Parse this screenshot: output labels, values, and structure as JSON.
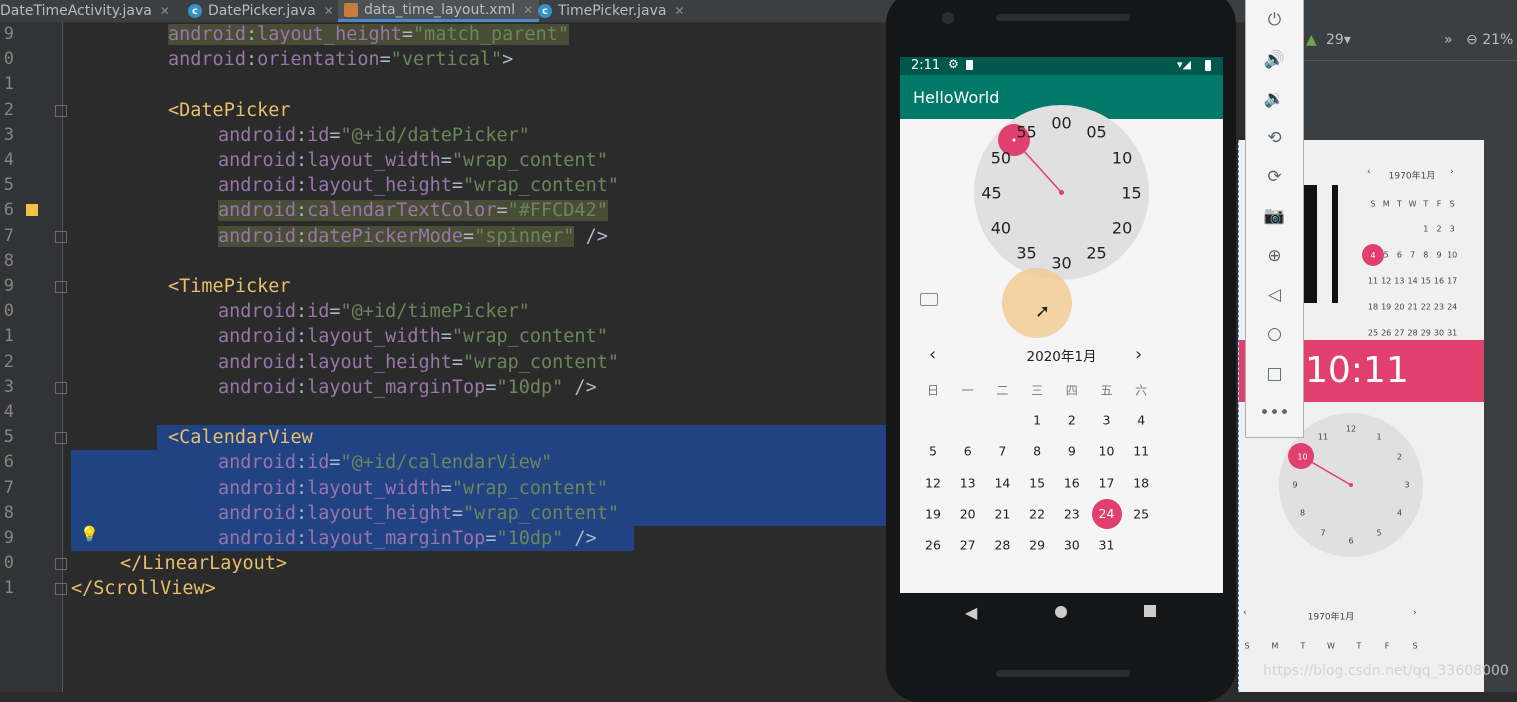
{
  "tabs": [
    {
      "label": "DateTimeActivity.java"
    },
    {
      "label": "DatePicker.java"
    },
    {
      "label": "data_time_layout.xml"
    },
    {
      "label": "TimePicker.java"
    }
  ],
  "editor": {
    "line_numbers": [
      "9",
      "0",
      "1",
      "2",
      "3",
      "4",
      "5",
      "6",
      "7",
      "8",
      "9",
      "0",
      "1",
      "2",
      "3",
      "4",
      "5",
      "6",
      "7",
      "8",
      "9",
      "0",
      "1"
    ],
    "lines": [
      {
        "tokens": [
          [
            "k",
            "android"
          ],
          [
            "p",
            ":"
          ],
          [
            "k",
            "layout_height"
          ],
          [
            "p",
            "="
          ],
          [
            "v",
            "\"match_parent\""
          ]
        ]
      },
      {
        "tokens": [
          [
            "k",
            "android"
          ],
          [
            "p",
            ":"
          ],
          [
            "k",
            "orientation"
          ],
          [
            "p",
            "="
          ],
          [
            "v",
            "\"vertical\""
          ],
          [
            "p",
            ">"
          ]
        ]
      },
      {
        "tokens": []
      },
      {
        "tokens": [
          [
            "t",
            "<DatePicker"
          ]
        ]
      },
      {
        "tokens": [
          [
            "k",
            "android"
          ],
          [
            "p",
            ":"
          ],
          [
            "k",
            "id"
          ],
          [
            "p",
            "="
          ],
          [
            "v",
            "\"@+id/datePicker\""
          ]
        ]
      },
      {
        "tokens": [
          [
            "k",
            "android"
          ],
          [
            "p",
            ":"
          ],
          [
            "k",
            "layout_width"
          ],
          [
            "p",
            "="
          ],
          [
            "v",
            "\"wrap_content\""
          ]
        ]
      },
      {
        "tokens": [
          [
            "k",
            "android"
          ],
          [
            "p",
            ":"
          ],
          [
            "k",
            "layout_height"
          ],
          [
            "p",
            "="
          ],
          [
            "v",
            "\"wrap_content\""
          ]
        ]
      },
      {
        "tokens": [
          [
            "k",
            "android"
          ],
          [
            "p",
            ":"
          ],
          [
            "k",
            "calendarTextColor"
          ],
          [
            "p",
            "="
          ],
          [
            "v",
            "\"#FFCD42\""
          ]
        ]
      },
      {
        "tokens": [
          [
            "k",
            "android"
          ],
          [
            "p",
            ":"
          ],
          [
            "k",
            "datePickerMode"
          ],
          [
            "p",
            "="
          ],
          [
            "v",
            "\"spinner\""
          ],
          [
            "p",
            " />"
          ]
        ]
      },
      {
        "tokens": []
      },
      {
        "tokens": [
          [
            "t",
            "<TimePicker"
          ]
        ]
      },
      {
        "tokens": [
          [
            "k",
            "android"
          ],
          [
            "p",
            ":"
          ],
          [
            "k",
            "id"
          ],
          [
            "p",
            "="
          ],
          [
            "v",
            "\"@+id/timePicker\""
          ]
        ]
      },
      {
        "tokens": [
          [
            "k",
            "android"
          ],
          [
            "p",
            ":"
          ],
          [
            "k",
            "layout_width"
          ],
          [
            "p",
            "="
          ],
          [
            "v",
            "\"wrap_content\""
          ]
        ]
      },
      {
        "tokens": [
          [
            "k",
            "android"
          ],
          [
            "p",
            ":"
          ],
          [
            "k",
            "layout_height"
          ],
          [
            "p",
            "="
          ],
          [
            "v",
            "\"wrap_content\""
          ]
        ]
      },
      {
        "tokens": [
          [
            "k",
            "android"
          ],
          [
            "p",
            ":"
          ],
          [
            "k",
            "layout_marginTop"
          ],
          [
            "p",
            "="
          ],
          [
            "v",
            "\"10dp\""
          ],
          [
            "p",
            " />"
          ]
        ]
      },
      {
        "tokens": []
      },
      {
        "tokens": [
          [
            "t",
            "<CalendarView"
          ]
        ]
      },
      {
        "tokens": [
          [
            "k",
            "android"
          ],
          [
            "p",
            ":"
          ],
          [
            "k",
            "id"
          ],
          [
            "p",
            "="
          ],
          [
            "v",
            "\"@+id/calendarView\""
          ]
        ]
      },
      {
        "tokens": [
          [
            "k",
            "android"
          ],
          [
            "p",
            ":"
          ],
          [
            "k",
            "layout_width"
          ],
          [
            "p",
            "="
          ],
          [
            "v",
            "\"wrap_content\""
          ]
        ]
      },
      {
        "tokens": [
          [
            "k",
            "android"
          ],
          [
            "p",
            ":"
          ],
          [
            "k",
            "layout_height"
          ],
          [
            "p",
            "="
          ],
          [
            "v",
            "\"wrap_content\""
          ]
        ]
      },
      {
        "tokens": [
          [
            "k",
            "android"
          ],
          [
            "p",
            ":"
          ],
          [
            "k",
            "layout_marginTop"
          ],
          [
            "p",
            "="
          ],
          [
            "v",
            "\"10dp\""
          ],
          [
            "p",
            " />"
          ]
        ]
      },
      {
        "tokens": [
          [
            "t",
            "</LinearLayout>"
          ]
        ]
      },
      {
        "tokens": [
          [
            "t",
            "</ScrollView>"
          ]
        ]
      }
    ]
  },
  "phone": {
    "status_time": "2:11",
    "app_title": "HelloWorld",
    "clock_numbers": [
      "00",
      "05",
      "10",
      "15",
      "20",
      "25",
      "30",
      "35",
      "40",
      "45",
      "50",
      "55"
    ],
    "calendar_title": "2020年1月",
    "weekdays": [
      "日",
      "一",
      "二",
      "三",
      "四",
      "五",
      "六"
    ],
    "days": [
      [
        "",
        "",
        "",
        "1",
        "2",
        "3",
        "4"
      ],
      [
        "5",
        "6",
        "7",
        "8",
        "9",
        "10",
        "11"
      ],
      [
        "12",
        "13",
        "14",
        "15",
        "16",
        "17",
        "18"
      ],
      [
        "19",
        "20",
        "21",
        "22",
        "23",
        "24",
        "25"
      ],
      [
        "26",
        "27",
        "28",
        "29",
        "30",
        "31",
        ""
      ]
    ],
    "selected_day": "24",
    "prev_icon": "‹",
    "next_icon": "›"
  },
  "studio": {
    "device_label": "29",
    "zoom_label": "21%"
  },
  "preview": {
    "calendar_title_top": "1970年1月",
    "mini_weekdays": [
      "S",
      "M",
      "T",
      "W",
      "T",
      "F",
      "S"
    ],
    "mini_days": [
      [
        "",
        "",
        "",
        "",
        "1",
        "2",
        "3"
      ],
      [
        "4",
        "5",
        "6",
        "7",
        "8",
        "9",
        "10"
      ],
      [
        "11",
        "12",
        "13",
        "14",
        "15",
        "16",
        "17"
      ],
      [
        "18",
        "19",
        "20",
        "21",
        "22",
        "23",
        "24"
      ],
      [
        "25",
        "26",
        "27",
        "28",
        "29",
        "30",
        "31"
      ]
    ],
    "time_text": "10:11",
    "analog_numbers": [
      "12",
      "1",
      "2",
      "3",
      "4",
      "5",
      "6",
      "7",
      "8",
      "9",
      "10",
      "11"
    ],
    "calendar_title_bottom": "1970年1月"
  },
  "watermark": "https://blog.csdn.net/qq_33608000"
}
